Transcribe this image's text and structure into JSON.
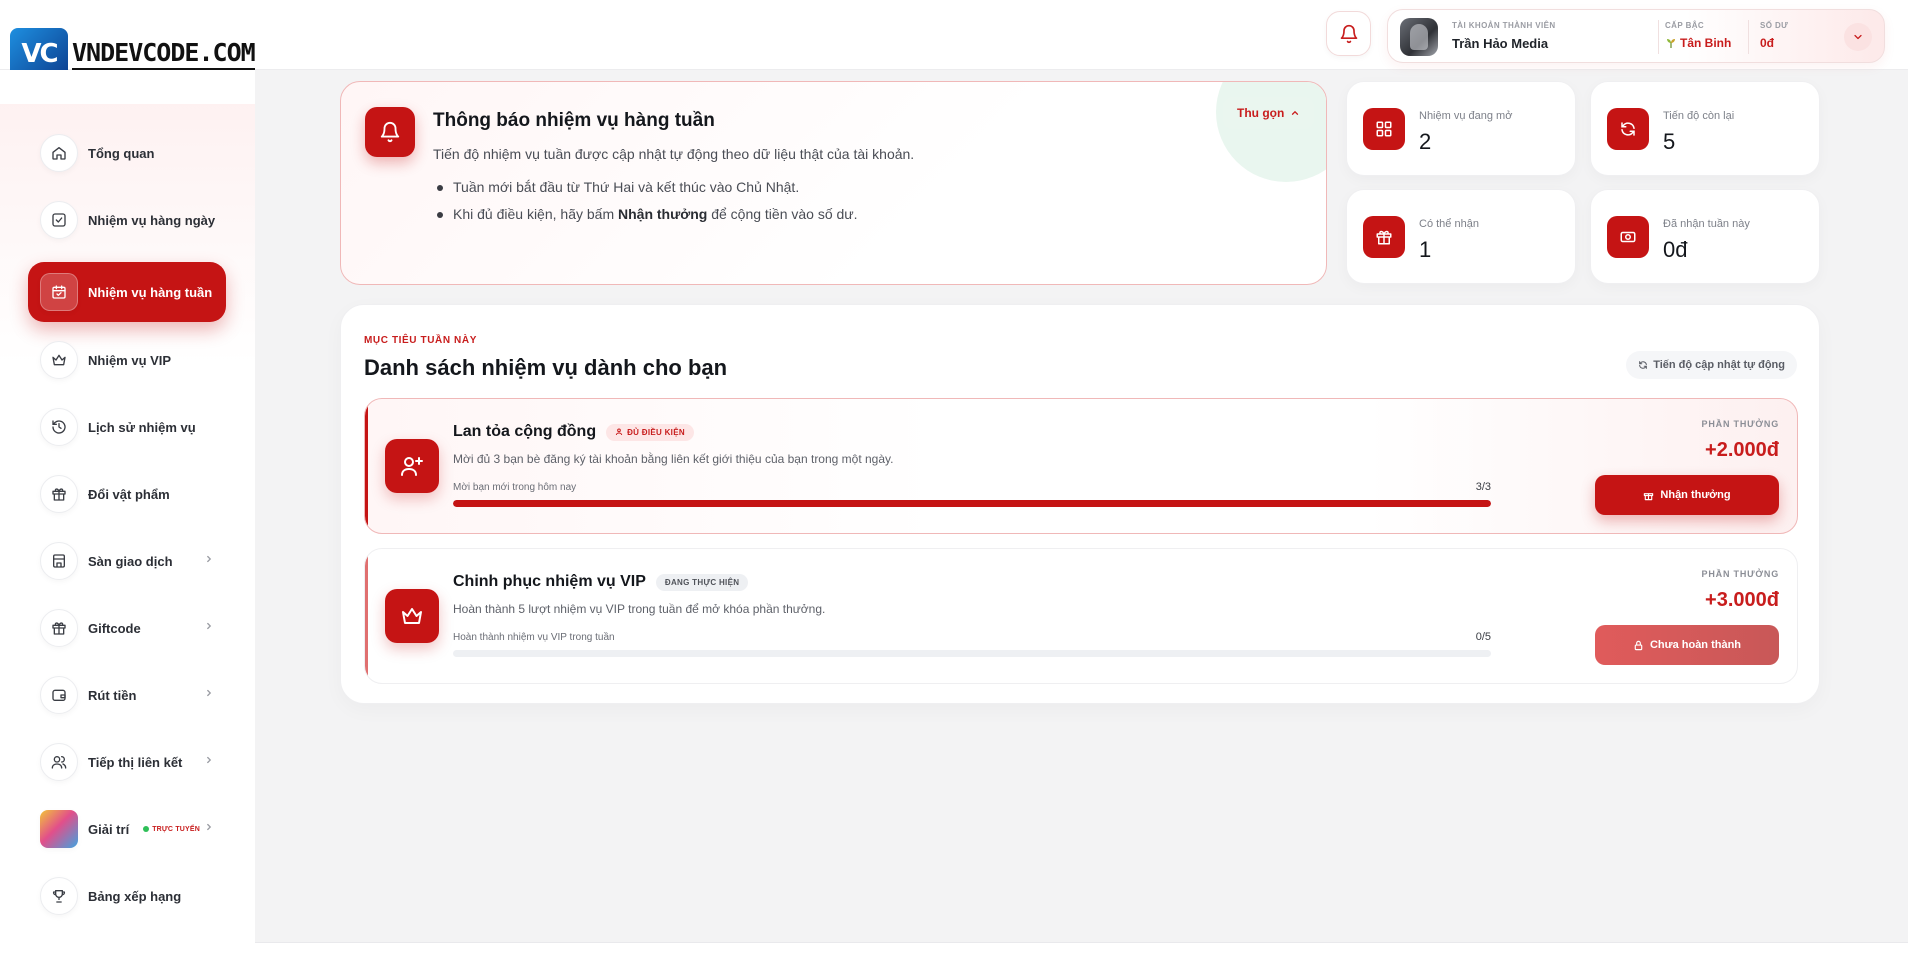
{
  "brand": {
    "logo_mark": "VC",
    "name": "VNDEVCODE.COM"
  },
  "account": {
    "member_label": "TÀI KHOẢN THÀNH VIÊN",
    "name": "Trần Hảo Media",
    "rank_label": "CẤP BẬC",
    "rank": "Tân Binh",
    "balance_label": "SỐ DƯ",
    "balance": "0đ"
  },
  "sidebar": {
    "items": [
      {
        "label": "Tổng quan",
        "icon": "home-icon"
      },
      {
        "label": "Nhiệm vụ hàng ngày",
        "icon": "checkbox-icon"
      },
      {
        "label": "Nhiệm vụ hàng tuần",
        "icon": "calendar-check-icon",
        "active": true
      },
      {
        "label": "Nhiệm vụ VIP",
        "icon": "crown-icon"
      },
      {
        "label": "Lịch sử nhiệm vụ",
        "icon": "history-icon"
      },
      {
        "label": "Đổi vật phẩm",
        "icon": "gift-icon"
      },
      {
        "label": "Sàn giao dịch",
        "icon": "store-icon"
      },
      {
        "label": "Giftcode",
        "icon": "gift-icon"
      },
      {
        "label": "Rút tiền",
        "icon": "wallet-icon"
      },
      {
        "label": "Tiếp thị liên kết",
        "icon": "users-icon"
      },
      {
        "label": "Giải trí",
        "icon": "game-thumbnail",
        "badge": "TRỰC TUYẾN"
      },
      {
        "label": "Bảng xếp hạng",
        "icon": "trophy-icon"
      }
    ]
  },
  "notice": {
    "title": "Thông báo nhiệm vụ hàng tuần",
    "description": "Tiến độ nhiệm vụ tuần được cập nhật tự động theo dữ liệu thật của tài khoản.",
    "bullet_1": "Tuần mới bắt đầu từ Thứ Hai và kết thúc vào Chủ Nhật.",
    "bullet_2_pre": "Khi đủ điều kiện, hãy bấm ",
    "bullet_2_bold": "Nhận thưởng",
    "bullet_2_post": " để cộng tiền vào số dư.",
    "collapse_label": "Thu gọn"
  },
  "stats": [
    {
      "label": "Nhiệm vụ đang mở",
      "value": "2",
      "icon": "grid-icon"
    },
    {
      "label": "Tiến độ còn lại",
      "value": "5",
      "icon": "refresh-icon"
    },
    {
      "label": "Có thể nhận",
      "value": "1",
      "icon": "gift-icon"
    },
    {
      "label": "Đã nhận tuần này",
      "value": "0đ",
      "icon": "cash-icon"
    }
  ],
  "missions": {
    "kicker": "MỤC TIÊU TUẦN NÀY",
    "title": "Danh sách nhiệm vụ dành cho bạn",
    "auto_update": "Tiến độ cập nhật tự động",
    "tasks": [
      {
        "name": "Lan tỏa cộng đồng",
        "badge": "ĐỦ ĐIỀU KIỆN",
        "description": "Mời đủ 3 bạn bè đăng ký tài khoản bằng liên kết giới thiệu của bạn trong một ngày.",
        "progress_label": "Mời bạn mới trong hôm nay",
        "progress_count": "3/3",
        "progress": 1.0,
        "reward_label": "PHẦN THƯỞNG",
        "reward": "+2.000đ",
        "button": "Nhận thưởng"
      },
      {
        "name": "Chinh phục nhiệm vụ VIP",
        "badge": "ĐANG THỰC HIỆN",
        "description": "Hoàn thành 5 lượt nhiệm vụ VIP trong tuần để mở khóa phần thưởng.",
        "progress_label": "Hoàn thành nhiệm vụ VIP trong tuần",
        "progress_count": "0/5",
        "progress": 0.0,
        "reward_label": "PHẦN THƯỞNG",
        "reward": "+3.000đ",
        "button": "Chưa hoàn thành"
      }
    ]
  },
  "colors": {
    "accent": "#c51414",
    "success": "#2fbf58"
  }
}
